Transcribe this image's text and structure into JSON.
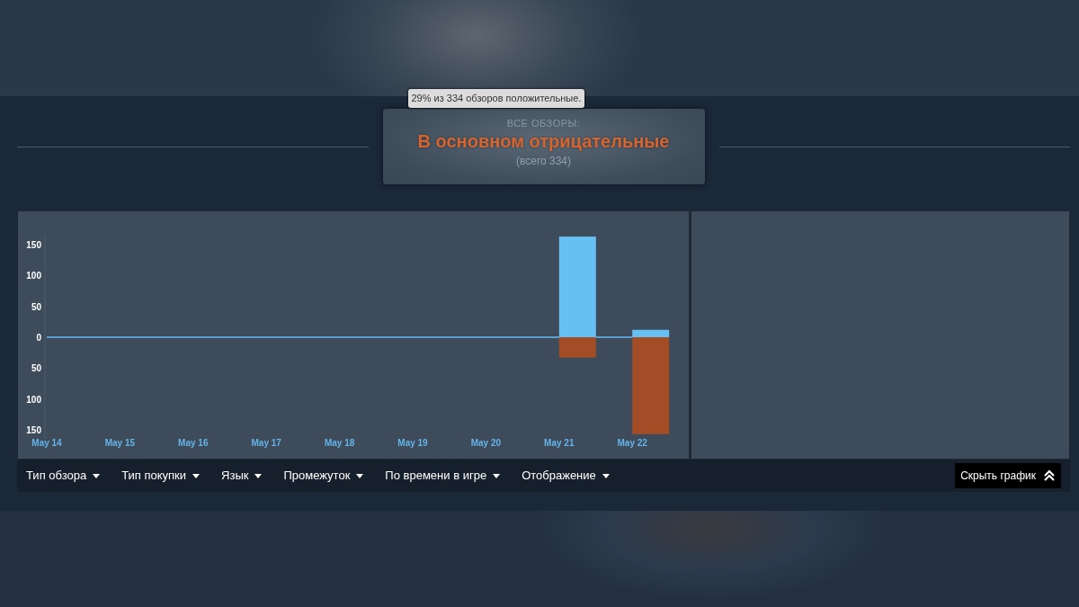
{
  "summary": {
    "tooltip": "29% из 334 обзоров положительные.",
    "label": "ВСЕ ОБЗОРЫ:",
    "rating": "В основном отрицательные",
    "total": "(всего 334)"
  },
  "chart": {
    "chart_data": {
      "type": "bar",
      "stacked": true,
      "categories": [
        "May 14",
        "May 15",
        "May 16",
        "May 17",
        "May 18",
        "May 19",
        "May 20",
        "May 21",
        "May 22"
      ],
      "series": [
        {
          "color": "#66c0f4",
          "values": [
            0,
            0,
            0,
            0,
            0,
            0,
            0,
            163,
            12
          ]
        },
        {
          "color": "#a34c25",
          "values": [
            0,
            0,
            0,
            0,
            0,
            0,
            0,
            -33,
            -157
          ]
        }
      ],
      "ylim": [
        -165,
        165
      ],
      "ref_lines": [
        {
          "axis": "y",
          "value": 0,
          "color": "#5b9fd0"
        }
      ],
      "yticks": [
        {
          "value": 150,
          "label": "150"
        },
        {
          "value": 100,
          "label": "100"
        },
        {
          "value": 50,
          "label": "50"
        },
        {
          "value": 0,
          "label": "0"
        },
        {
          "value": -50,
          "label": "50"
        },
        {
          "value": -100,
          "label": "100"
        },
        {
          "value": -150,
          "label": "150"
        }
      ]
    }
  },
  "filters": [
    {
      "label": "Тип обзора"
    },
    {
      "label": "Тип покупки"
    },
    {
      "label": "Язык"
    },
    {
      "label": "Промежуток"
    },
    {
      "label": "По времени в игре"
    },
    {
      "label": "Отображение"
    }
  ],
  "hide_button": {
    "label": "Скрыть график"
  }
}
